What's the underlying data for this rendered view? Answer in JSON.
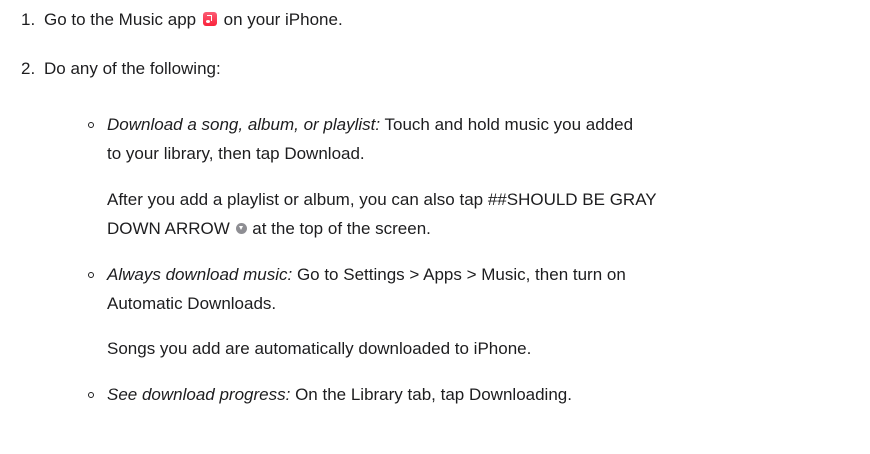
{
  "steps": [
    {
      "number": "1.",
      "text_before_icon": "Go to the Music app",
      "icon": "music-app-icon",
      "text_after_icon": "on your iPhone."
    },
    {
      "number": "2.",
      "text": "Do any of the following:"
    }
  ],
  "options": [
    {
      "title": "Download a song, album, or playlist:",
      "line1_rest": "Touch and hold music you added",
      "line2": "to your library, then tap Download.",
      "note_line1": "After you add a playlist or album, you can also tap ##SHOULD BE GRAY",
      "note_line2_before_icon": "DOWN ARROW",
      "note_icon": "gray-down-arrow-icon",
      "note_line2_after_icon": "at the top of the screen."
    },
    {
      "title": "Always download music:",
      "line1_rest": "Go to Settings > Apps > Music, then turn on",
      "line2": "Automatic Downloads.",
      "note_line1": "Songs you add are automatically downloaded to iPhone."
    },
    {
      "title": "See download progress:",
      "line1_rest": "On the Library tab, tap Downloading."
    }
  ],
  "colors": {
    "text": "#1d1d1f",
    "music_icon": "#fa233b",
    "gray_icon": "#8e8e93"
  }
}
